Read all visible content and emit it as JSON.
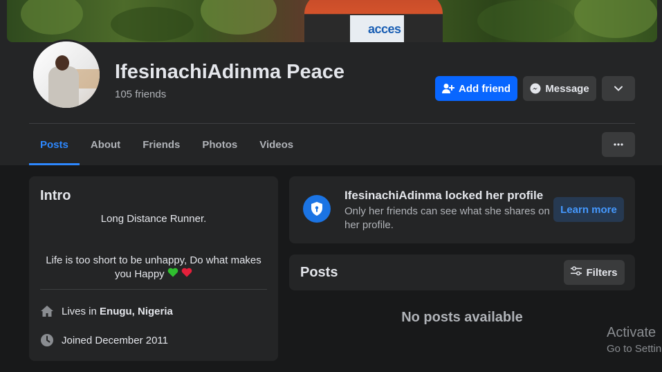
{
  "profile": {
    "name": "IfesinachiAdinma Peace",
    "friends_count": "105 friends",
    "actions": {
      "add_friend": "Add friend",
      "message": "Message"
    }
  },
  "cover": {
    "bib_text": "acces"
  },
  "tabs": [
    {
      "label": "Posts",
      "active": true
    },
    {
      "label": "About",
      "active": false
    },
    {
      "label": "Friends",
      "active": false
    },
    {
      "label": "Photos",
      "active": false
    },
    {
      "label": "Videos",
      "active": false
    }
  ],
  "intro": {
    "title": "Intro",
    "bio_line_1": "Long Distance Runner.",
    "bio_line_2a": "Life is too short to be unhappy, Do what makes",
    "bio_line_2b": "you Happy",
    "lives_prefix": "Lives in",
    "lives_place": "Enugu, Nigeria",
    "joined": "Joined December 2011"
  },
  "locked_notice": {
    "title": "IfesinachiAdinma locked her profile",
    "description": "Only her friends can see what she shares on her profile.",
    "button": "Learn more"
  },
  "posts": {
    "title": "Posts",
    "filters_label": "Filters",
    "empty_message": "No posts available"
  },
  "watermark": {
    "line_1": "Activate",
    "line_2": "Go to Settin"
  },
  "colors": {
    "accent": "#0866ff",
    "tab_active": "#2d88ff",
    "background": "#18191a",
    "card": "#242526"
  },
  "icons": {
    "add_friend": "person-plus-icon",
    "message": "messenger-icon",
    "more": "chevron-down-icon",
    "tab_more": "ellipsis-icon",
    "lock": "shield-lock-icon",
    "filters": "sliders-icon",
    "home": "home-icon",
    "clock": "clock-icon"
  }
}
